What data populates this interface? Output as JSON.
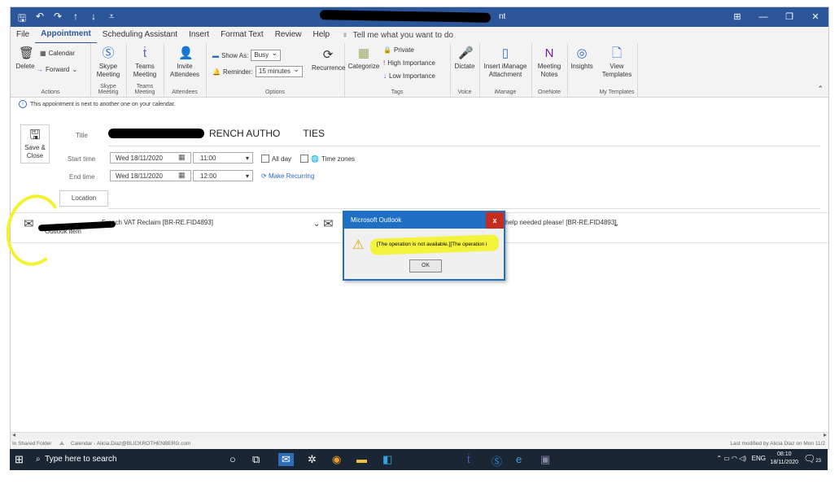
{
  "window": {
    "title_suffix": "nt"
  },
  "tabs": [
    "File",
    "Appointment",
    "Scheduling Assistant",
    "Insert",
    "Format Text",
    "Review",
    "Help"
  ],
  "tellme": "Tell me what you want to do",
  "ribbon": {
    "actions": {
      "delete": "Delete",
      "calendar": "Calendar",
      "forward": "Forward",
      "label": "Actions"
    },
    "skype": {
      "btn": "Skype Meeting",
      "label": "Skype Meeting"
    },
    "teams": {
      "btn": "Teams Meeting",
      "label": "Teams Meeting"
    },
    "attendees": {
      "btn": "Invite Attendees",
      "label": "Attendees"
    },
    "options": {
      "showas": "Show As:",
      "busy": "Busy",
      "reminder": "Reminder:",
      "reminder_val": "15 minutes",
      "recurrence": "Recurrence",
      "label": "Options"
    },
    "tags": {
      "categorize": "Categorize",
      "private": "Private",
      "high": "High Importance",
      "low": "Low Importance",
      "label": "Tags"
    },
    "voice": {
      "btn": "Dictate",
      "label": "Voice"
    },
    "imanage": {
      "btn": "Insert iManage Attachment",
      "label": "iManage"
    },
    "onenote": {
      "btn": "Meeting Notes",
      "label": "OneNote"
    },
    "insights": {
      "btn": "Insights"
    },
    "templates": {
      "btn": "View Templates",
      "label": "My Templates"
    }
  },
  "infobar": "This appointment is next to another one on your calendar.",
  "form": {
    "save": "Save & Close",
    "title_label": "Title",
    "title_value": "RENCH AUTHO",
    "title_tail": "TIES",
    "start_label": "Start time",
    "start_date": "Wed 18/11/2020",
    "start_time": "11:00",
    "end_label": "End time",
    "end_date": "Wed 18/11/2020",
    "end_time": "12:00",
    "allday": "All day",
    "timezones": "Time zones",
    "make_recurring": "Make Recurring",
    "location": "Location"
  },
  "attachments": {
    "a1_text": "French VAT Reclaim [BR-RE.FID4893]",
    "a1_sub": "Outlook item",
    "a3_text": "help needed please! [BR-RE.FID4893]"
  },
  "dialog": {
    "title": "Microsoft Outlook",
    "message": "[The operation is not available.][The operation i",
    "ok": "OK",
    "close": "x"
  },
  "status": {
    "left": "In Shared Folder",
    "calendar": "Calendar - Alicia.Diaz@BLICKROTHENBERG.com",
    "right": "Last modified by Alicia Diaz on Mon 11/2"
  },
  "taskbar": {
    "search": "Type here to search",
    "lang": "ENG",
    "time": "08:10",
    "date": "18/11/2020",
    "notif_count": "23"
  }
}
